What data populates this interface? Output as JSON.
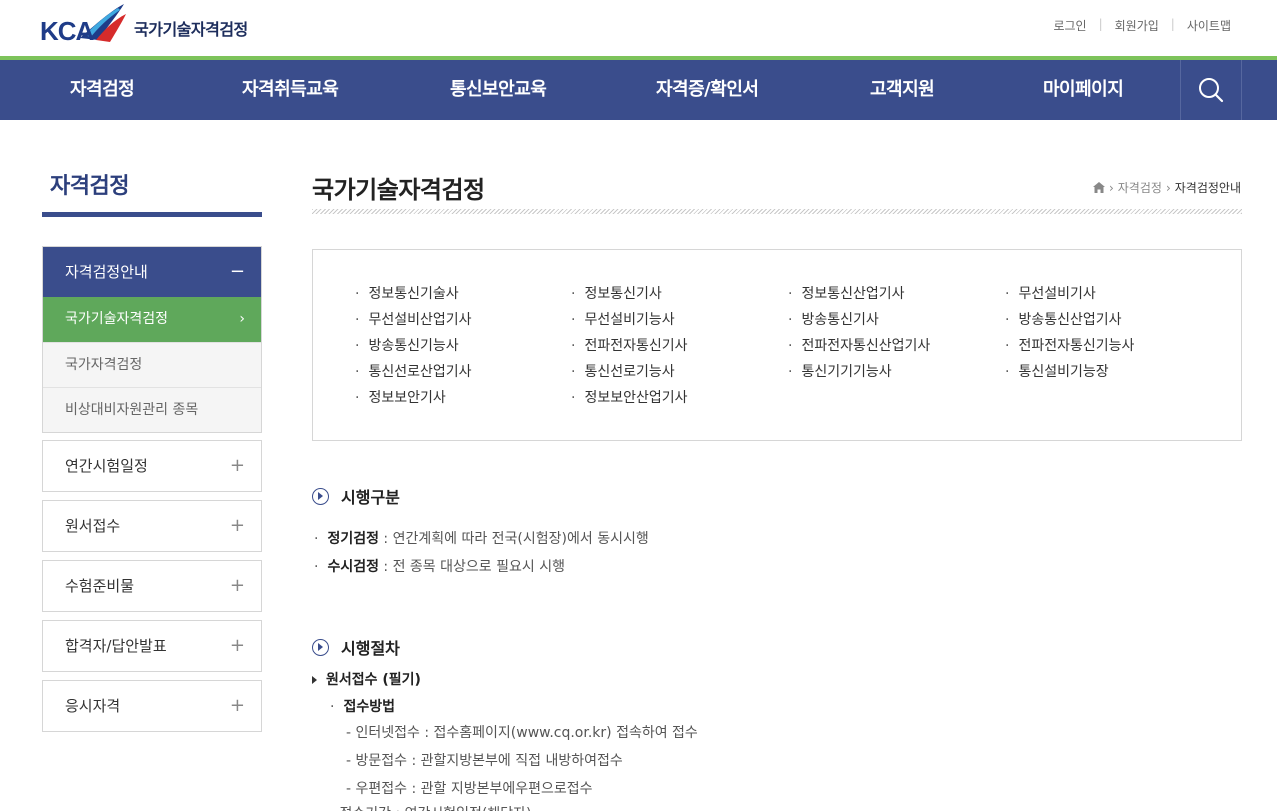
{
  "header": {
    "logo_text": "KCA",
    "org_name": "국가기술자격검정",
    "util_links": [
      "로그인",
      "회원가입",
      "사이트맵"
    ]
  },
  "gnb": {
    "items": [
      "자격검정",
      "자격취득교육",
      "통신보안교육",
      "자격증/확인서",
      "고객지원",
      "마이페이지"
    ]
  },
  "sidebar": {
    "title": "자격검정",
    "group": {
      "label": "자격검정안내",
      "children": [
        "국가기술자격검정",
        "국가자격검정",
        "비상대비자원관리 종목"
      ]
    },
    "items": [
      "연간시험일정",
      "원서접수",
      "수험준비물",
      "합격자/답안발표",
      "응시자격"
    ]
  },
  "page": {
    "title": "국가기술자격검정",
    "breadcrumb": [
      "자격검정",
      "자격검정안내"
    ]
  },
  "certs": [
    "정보통신기술사",
    "정보통신기사",
    "정보통신산업기사",
    "무선설비기사",
    "무선설비산업기사",
    "무선설비기능사",
    "방송통신기사",
    "방송통신산업기사",
    "방송통신기능사",
    "전파전자통신기사",
    "전파전자통신산업기사",
    "전파전자통신기능사",
    "통신선로산업기사",
    "통신선로기능사",
    "통신기기기능사",
    "통신설비기능장",
    "정보보안기사",
    "정보보안산업기사"
  ],
  "section1": {
    "title": "시행구분",
    "lines": [
      {
        "term": "정기검정",
        "desc": " : 연간계획에 따라 전국(시험장)에서 동시시행"
      },
      {
        "term": "수시검정",
        "desc": " : 전 종목 대상으로 필요시 시행"
      }
    ]
  },
  "section2": {
    "title": "시행절차",
    "step": "원서접수 (필기)",
    "sub_title": "접수방법",
    "methods": [
      "- 인터넷접수 : 접수홈페이지(www.cq.or.kr) 접속하여 접수",
      "- 방문접수 : 관할지방본부에 직접 내방하여접수",
      "- 우편접수 : 관할 지방본부에우편으로접수"
    ],
    "partial": "- 접수기간 : 연간시험일정(해당자)"
  },
  "colors": {
    "navy": "#3a4d8c",
    "green": "#7dc35b",
    "menu_active": "#5fa85b"
  }
}
